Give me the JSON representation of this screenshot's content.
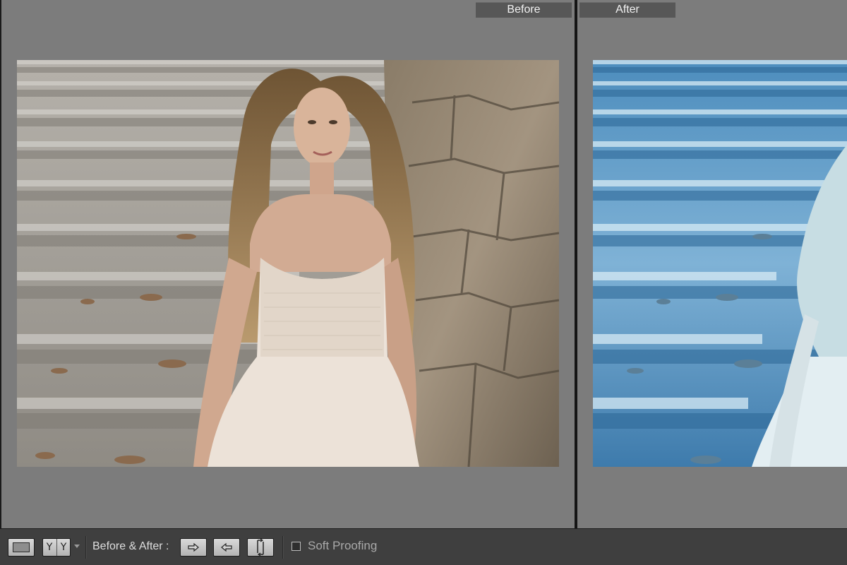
{
  "before_pane": {
    "label": "Before"
  },
  "after_pane": {
    "label": "After"
  },
  "toolbar": {
    "view_mode_icon": "loupe-view-icon",
    "before_after_mode_icon": "yy-side-by-side-icon",
    "dropdown_icon": "chevron-down-icon",
    "before_after_label": "Before & After :",
    "copy_before_to_after_icon": "arrow-right-icon",
    "copy_after_to_before_icon": "arrow-left-icon",
    "swap_icon": "swap-arrows-icon",
    "soft_proofing_label": "Soft Proofing",
    "soft_proofing_checked": false
  },
  "colors": {
    "canvas": "#7c7c7c",
    "toolbar": "#3f3f3f",
    "label_bg": "#575757",
    "after_tint": "#3f7fae"
  }
}
